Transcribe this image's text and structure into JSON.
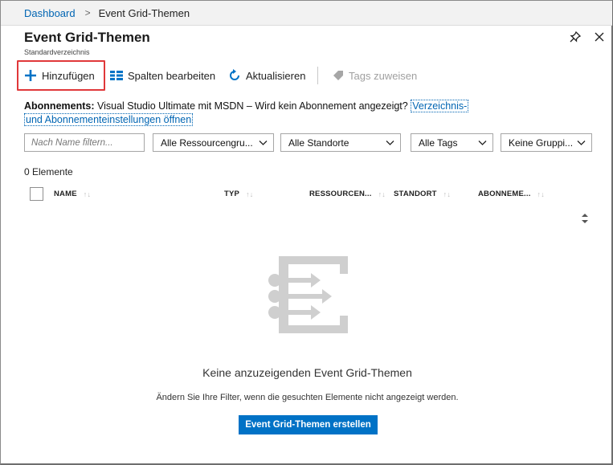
{
  "breadcrumb": {
    "root": "Dashboard",
    "separator": ">",
    "current": "Event Grid-Themen"
  },
  "blade": {
    "title": "Event Grid-Themen",
    "subtitle": "Standardverzeichnis"
  },
  "toolbar": {
    "add_label": "Hinzufügen",
    "columns_label": "Spalten bearbeiten",
    "refresh_label": "Aktualisieren",
    "tags_label": "Tags zuweisen"
  },
  "subscriptions": {
    "label": "Abonnements:",
    "text": " Visual Studio Ultimate mit MSDN – Wird kein Abonnement angezeigt? ",
    "link_line1": "Verzeichnis-",
    "link_line2": "und Abonnementeinstellungen öffnen"
  },
  "filters": {
    "name_placeholder": "Nach Name filtern...",
    "resource_group": "Alle Ressourcengru...",
    "locations": "Alle Standorte",
    "tags": "Alle Tags",
    "grouping": "Keine Gruppi..."
  },
  "count_text": "0 Elemente",
  "table": {
    "columns": [
      "NAME",
      "TYP",
      "RESSOURCEN...",
      "STANDORT",
      "ABONNEME..."
    ],
    "rows": []
  },
  "empty_state": {
    "title": "Keine anzuzeigenden Event Grid-Themen",
    "hint": "Ändern Sie Ihre Filter, wenn die gesuchten Elemente nicht angezeigt werden.",
    "button_label": "Event Grid-Themen erstellen"
  },
  "colors": {
    "accent": "#0072c6",
    "link": "#0065b3",
    "highlight": "#e0383a"
  }
}
